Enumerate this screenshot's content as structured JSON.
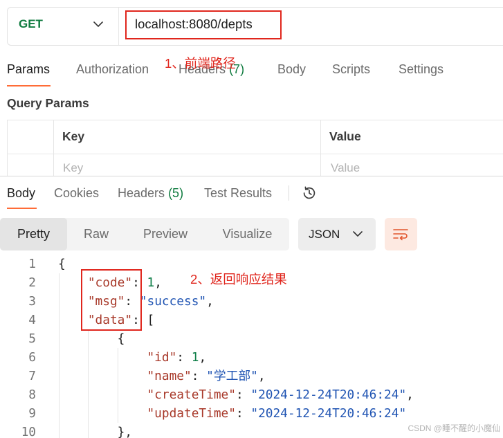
{
  "request": {
    "method": "GET",
    "url": "localhost:8080/depts",
    "tabs": [
      {
        "label": "Params",
        "active": true
      },
      {
        "label": "Authorization",
        "active": false
      },
      {
        "label": "Headers",
        "count": "(7)",
        "active": false
      },
      {
        "label": "Body",
        "active": false
      },
      {
        "label": "Scripts",
        "active": false
      },
      {
        "label": "Settings",
        "active": false
      }
    ],
    "query_params": {
      "title": "Query Params",
      "columns": [
        "Key",
        "Value"
      ],
      "rows": [
        {
          "key_placeholder": "Key",
          "value_placeholder": "Value"
        }
      ]
    }
  },
  "response": {
    "tabs": [
      {
        "label": "Body",
        "active": true
      },
      {
        "label": "Cookies",
        "active": false
      },
      {
        "label": "Headers",
        "count": "(5)",
        "active": false
      },
      {
        "label": "Test Results",
        "active": false
      }
    ],
    "view_modes": [
      {
        "label": "Pretty",
        "active": true
      },
      {
        "label": "Raw",
        "active": false
      },
      {
        "label": "Preview",
        "active": false
      },
      {
        "label": "Visualize",
        "active": false
      }
    ],
    "format": "JSON",
    "code_lines": [
      {
        "n": "1",
        "indent": "",
        "tokens": [
          {
            "t": "punctuation",
            "v": "{"
          }
        ]
      },
      {
        "n": "2",
        "indent": "    ",
        "tokens": [
          {
            "t": "key",
            "v": "\"code\""
          },
          {
            "t": "punctuation",
            "v": ": "
          },
          {
            "t": "number",
            "v": "1"
          },
          {
            "t": "punctuation",
            "v": ","
          }
        ]
      },
      {
        "n": "3",
        "indent": "    ",
        "tokens": [
          {
            "t": "key",
            "v": "\"msg\""
          },
          {
            "t": "punctuation",
            "v": ": "
          },
          {
            "t": "string",
            "v": "\"success\""
          },
          {
            "t": "punctuation",
            "v": ","
          }
        ]
      },
      {
        "n": "4",
        "indent": "    ",
        "tokens": [
          {
            "t": "key",
            "v": "\"data\""
          },
          {
            "t": "punctuation",
            "v": ": ["
          }
        ]
      },
      {
        "n": "5",
        "indent": "        ",
        "tokens": [
          {
            "t": "punctuation",
            "v": "{"
          }
        ]
      },
      {
        "n": "6",
        "indent": "            ",
        "tokens": [
          {
            "t": "key",
            "v": "\"id\""
          },
          {
            "t": "punctuation",
            "v": ": "
          },
          {
            "t": "number",
            "v": "1"
          },
          {
            "t": "punctuation",
            "v": ","
          }
        ]
      },
      {
        "n": "7",
        "indent": "            ",
        "tokens": [
          {
            "t": "key",
            "v": "\"name\""
          },
          {
            "t": "punctuation",
            "v": ": "
          },
          {
            "t": "string",
            "v": "\"学工部\""
          },
          {
            "t": "punctuation",
            "v": ","
          }
        ]
      },
      {
        "n": "8",
        "indent": "            ",
        "tokens": [
          {
            "t": "key",
            "v": "\"createTime\""
          },
          {
            "t": "punctuation",
            "v": ": "
          },
          {
            "t": "string",
            "v": "\"2024-12-24T20:46:24\""
          },
          {
            "t": "punctuation",
            "v": ","
          }
        ]
      },
      {
        "n": "9",
        "indent": "            ",
        "tokens": [
          {
            "t": "key",
            "v": "\"updateTime\""
          },
          {
            "t": "punctuation",
            "v": ": "
          },
          {
            "t": "string",
            "v": "\"2024-12-24T20:46:24\""
          }
        ]
      },
      {
        "n": "10",
        "indent": "        ",
        "tokens": [
          {
            "t": "punctuation",
            "v": "},"
          }
        ]
      }
    ]
  },
  "annotations": {
    "url_note": "1、前端路径",
    "response_note": "2、返回响应结果"
  },
  "watermark": "CSDN @睡不醒的小魔仙",
  "icons": {
    "method_dropdown": "chevron-down-icon",
    "history": "history-icon",
    "format_dropdown": "chevron-down-icon",
    "wrap_lines": "wrap-lines-icon"
  },
  "colors": {
    "accent": "#ff6c37",
    "method_get": "#0f7b3f",
    "count_badge": "#0f7b3f",
    "annotation": "#e0261d",
    "json_key": "#a8392a",
    "json_string": "#2155b3",
    "json_number": "#0d7d47"
  }
}
